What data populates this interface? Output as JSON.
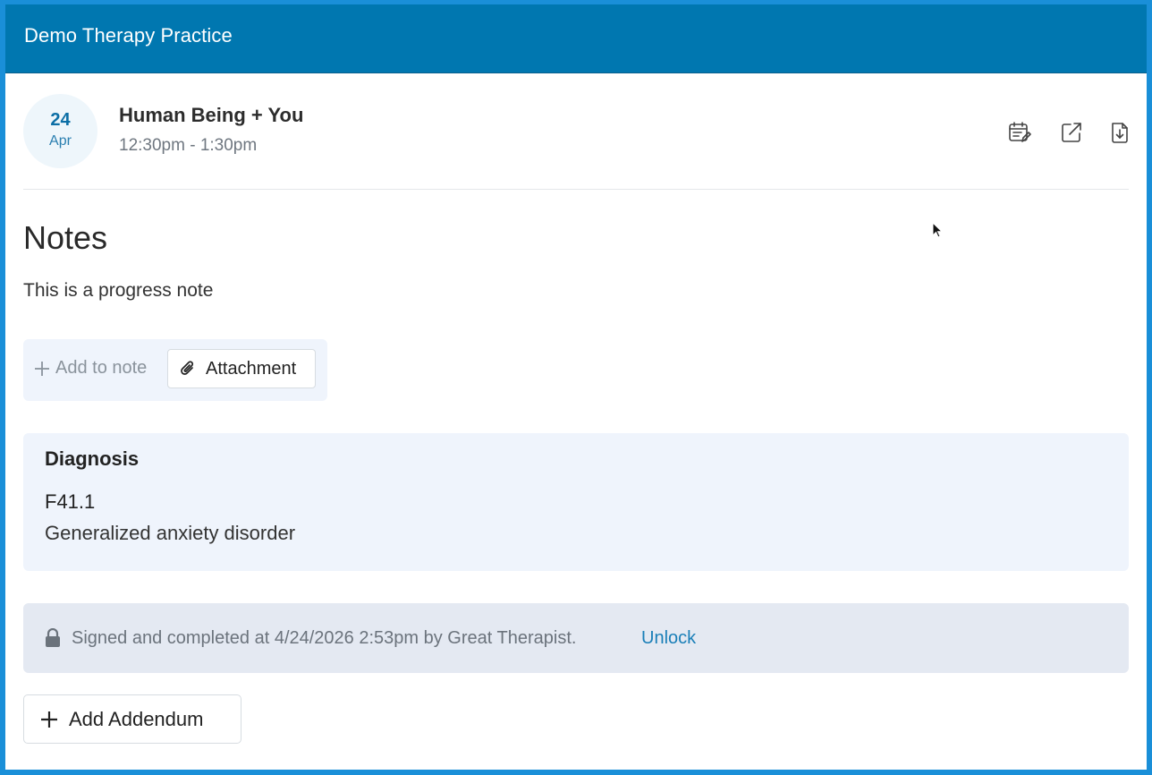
{
  "app": {
    "title": "Demo Therapy Practice"
  },
  "session": {
    "day": "24",
    "month": "Apr",
    "name": "Human Being + You",
    "time": "12:30pm - 1:30pm"
  },
  "header_icons": [
    "calendar-edit-icon",
    "external-link-icon",
    "download-file-icon"
  ],
  "notes": {
    "heading": "Notes",
    "body": "This is a progress note",
    "add_to_note_label": "Add to note",
    "attachment_label": "Attachment"
  },
  "diagnosis": {
    "label": "Diagnosis",
    "code": "F41.1",
    "description": "Generalized anxiety disorder"
  },
  "signature": {
    "text": "Signed and completed at 4/24/2026 2:53pm by Great Therapist.",
    "unlock_label": "Unlock"
  },
  "actions": {
    "add_addendum_label": "Add Addendum"
  },
  "colors": {
    "header_bg": "#0077b0",
    "frame": "#1a8fd8",
    "panel_bg": "#eff4fc",
    "signed_bg": "#e4e9f2",
    "link": "#1a7fb8"
  }
}
